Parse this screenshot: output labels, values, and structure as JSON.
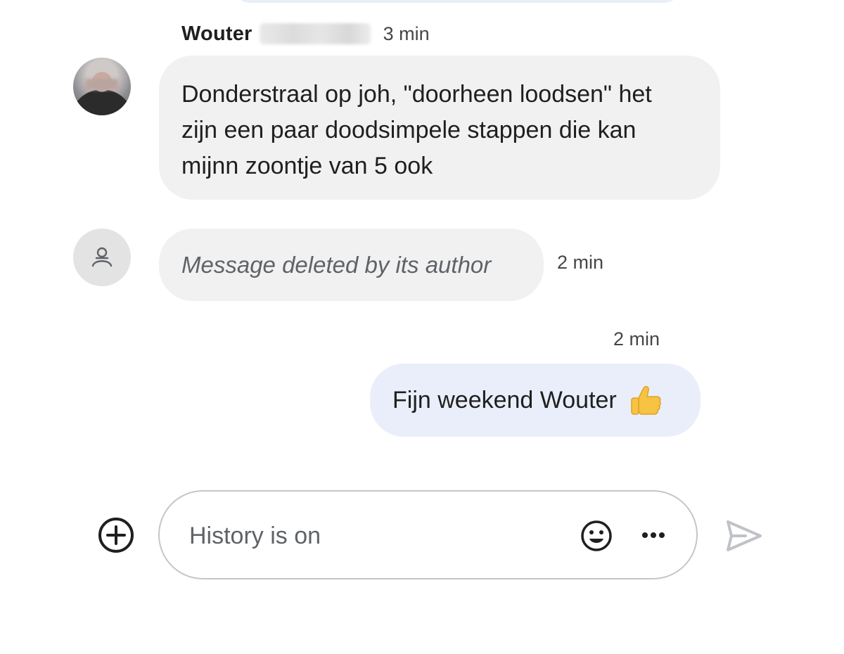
{
  "conversation": {
    "messages": [
      {
        "sender": "Wouter",
        "time": "3 min",
        "avatar_icon": "person-photo-avatar",
        "text_lines": [
          "Donderstraal op joh, \"doorheen loodsen\" het",
          "zijn een paar doodsimpele stappen die kan",
          "mijnn zoontje van 5 ook"
        ]
      },
      {
        "avatar_icon": "deleted-user-avatar-icon",
        "text": "Message deleted by its author",
        "time": "2 min"
      },
      {
        "time": "2 min",
        "text": "Fijn weekend Wouter",
        "emoji": "thumbs-up-icon"
      }
    ]
  },
  "composer": {
    "placeholder": "History is on",
    "value": "",
    "add_icon": "add-circle-icon",
    "emoji_icon": "emoji-icon",
    "more_icon": "more-horizontal-icon",
    "send_icon": "send-icon"
  },
  "colors": {
    "incoming_bubble": "#f1f1f1",
    "outgoing_bubble": "#e9eefa",
    "composer_border": "#c4c7c5",
    "send_icon": "#bfc3c8"
  }
}
